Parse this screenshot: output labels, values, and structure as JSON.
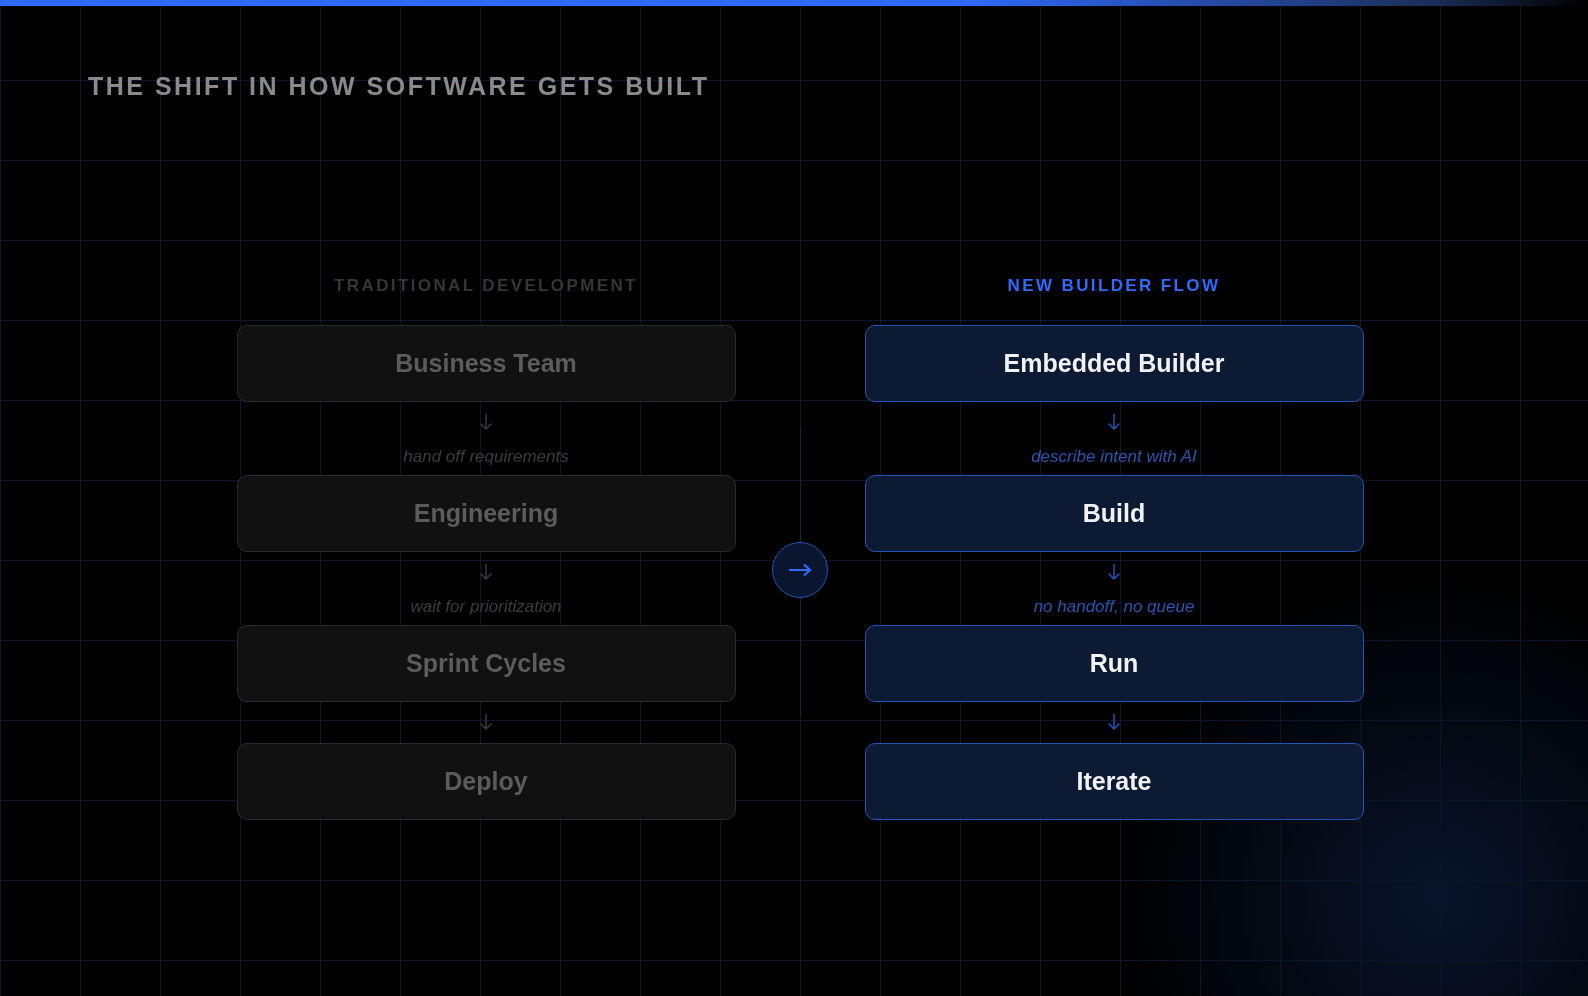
{
  "title": "THE SHIFT IN HOW SOFTWARE GETS BUILT",
  "columns": [
    {
      "kind": "traditional",
      "heading": "TRADITIONAL DEVELOPMENT",
      "steps": [
        {
          "label": "Business Team",
          "transition": "hand off requirements"
        },
        {
          "label": "Engineering",
          "transition": "wait for prioritization"
        },
        {
          "label": "Sprint Cycles"
        },
        {
          "label": "Deploy"
        }
      ]
    },
    {
      "kind": "builder",
      "heading": "NEW BUILDER FLOW",
      "steps": [
        {
          "label": "Embedded Builder",
          "transition": "describe intent with AI"
        },
        {
          "label": "Build",
          "transition": "no handoff, no queue"
        },
        {
          "label": "Run"
        },
        {
          "label": "Iterate"
        }
      ]
    }
  ]
}
